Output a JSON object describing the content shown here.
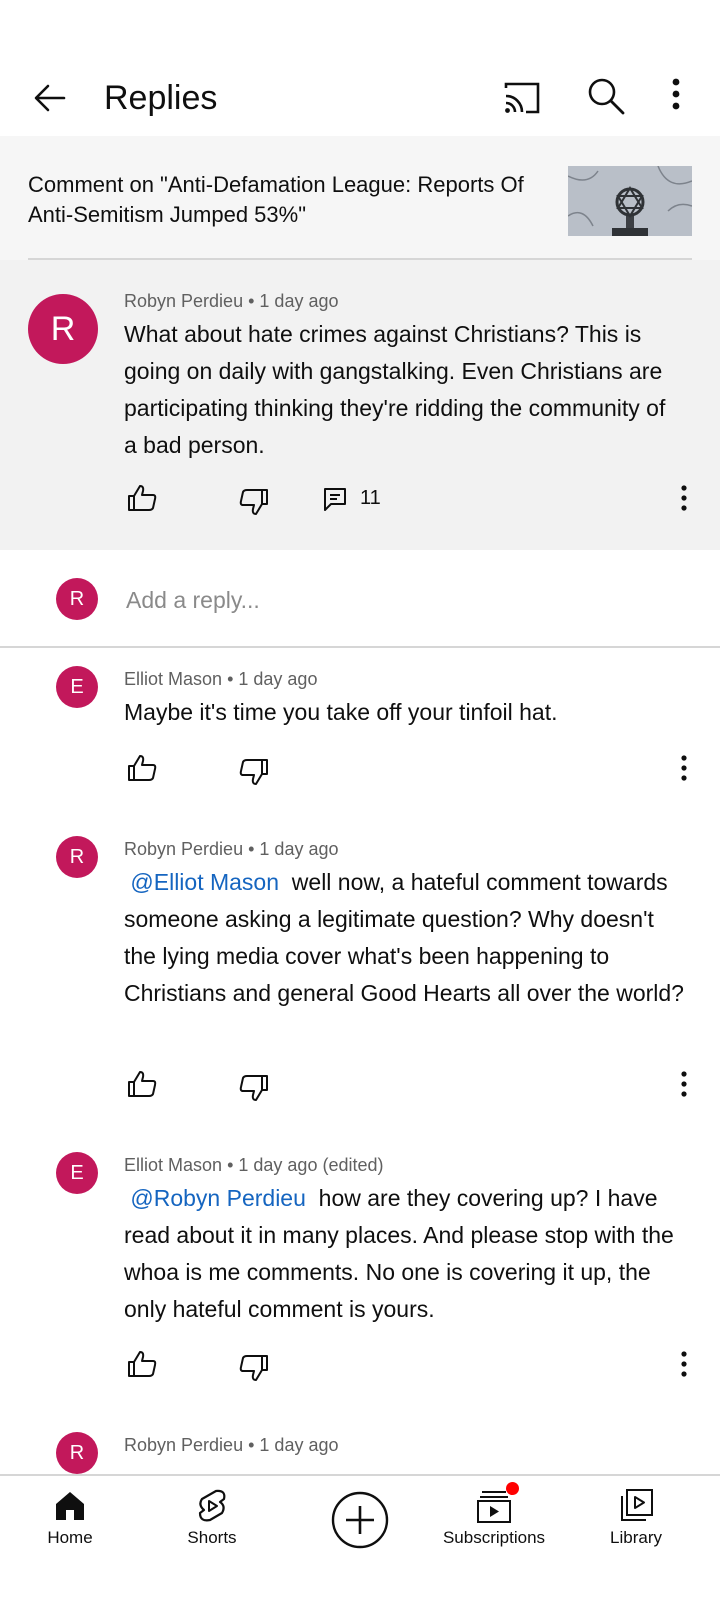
{
  "header": {
    "title": "Replies"
  },
  "context": {
    "text": "Comment on \"Anti-Defamation League: Reports Of Anti-Semitism Jumped 53%\""
  },
  "main_comment": {
    "avatar_letter": "R",
    "author": "Robyn Perdieu",
    "time": "1 day ago",
    "text": "What about hate crimes against Christians? This is going on daily with gangstalking.  Even Christians are participating thinking they're ridding the community of a bad person.",
    "reply_count": "11"
  },
  "add_reply": {
    "avatar_letter": "R",
    "placeholder": "Add a reply..."
  },
  "replies": [
    {
      "avatar_letter": "E",
      "author": "Elliot Mason",
      "time": "1 day ago",
      "mention": "",
      "text": "Maybe it's time you take off your tinfoil hat."
    },
    {
      "avatar_letter": "R",
      "author": "Robyn Perdieu",
      "time": "1 day ago",
      "mention": "@Elliot Mason",
      "text": "well now, a hateful comment towards someone asking a legitimate question? Why doesn't the lying media cover what's been happening to Christians and general Good Hearts all over the world?"
    },
    {
      "avatar_letter": "E",
      "author": "Elliot Mason",
      "time": "1 day ago (edited)",
      "mention": "@Robyn Perdieu",
      "text": "how are they covering up? I have read about it in many places. And please stop with the whoa is me comments. No one is covering it up, the only hateful comment is yours."
    },
    {
      "avatar_letter": "R",
      "author": "Robyn Perdieu",
      "time": "1 day ago"
    }
  ],
  "separator": "•",
  "nav": {
    "home": "Home",
    "shorts": "Shorts",
    "subscriptions": "Subscriptions",
    "library": "Library"
  },
  "colors": {
    "avatar": "#c2185b",
    "mention": "#1565c0",
    "notification_dot": "#ff0000"
  }
}
